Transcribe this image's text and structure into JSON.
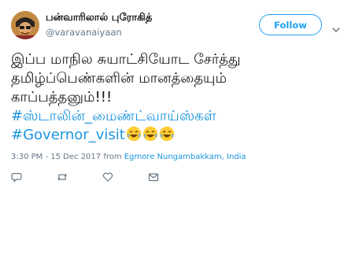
{
  "author": {
    "display_name": "பன்வாரிலால் புரோகித்",
    "username": "@varavanaiyaan"
  },
  "follow_label": "Follow",
  "tweet": {
    "lines": [
      "இப்ப மாநில சுயாட்சியோட சேர்த்து",
      "தமிழ்ப்பெண்களின் மானத்தையும்",
      "காப்பத்தனும்!!!"
    ],
    "hashtag1": "#ஸ்டாலின்_மைண்ட்வாய்ஸ்கள்",
    "hashtag2": "#Governor_visit",
    "emoji_names": [
      "laughing-tears-emoji",
      "laughing-tears-emoji",
      "laughing-tears-emoji"
    ]
  },
  "meta": {
    "timestamp": "3:30 PM - 15 Dec 2017 from",
    "location": "Egmore Nungambakkam, India"
  },
  "icons": {
    "reply": "reply-icon",
    "retweet": "retweet-icon",
    "like": "heart-icon",
    "message": "direct-message-icon",
    "caret": "chevron-down-icon"
  },
  "colors": {
    "accent": "#1da1f2",
    "link": "#1b95e0",
    "secondary": "#657786",
    "text": "#14171a"
  }
}
